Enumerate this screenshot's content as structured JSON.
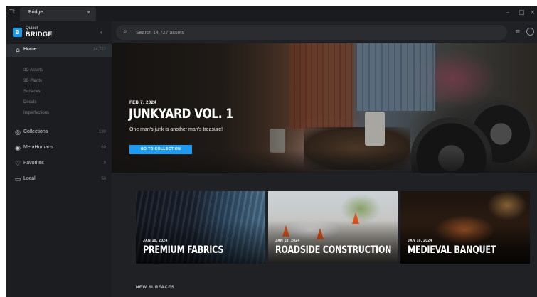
{
  "titlebar": {
    "app_glyph": "Tt",
    "tab_label": "Bridge",
    "tab_close": "×",
    "minimize": "–",
    "maximize": "□",
    "close": "×"
  },
  "sidebar": {
    "logo_mark": "B",
    "logo_brand": "Quixel",
    "logo_product": "BRIDGE",
    "collapse_glyph": "‹",
    "home": {
      "icon": "home-icon",
      "label": "Home",
      "count": "14,727"
    },
    "subitems": [
      "3D Assets",
      "3D Plants",
      "Surfaces",
      "Decals",
      "Imperfections"
    ],
    "items": [
      {
        "icon": "globe-icon",
        "label": "Collections",
        "count": "190"
      },
      {
        "icon": "metahuman-icon",
        "label": "MetaHumans",
        "count": "60"
      },
      {
        "icon": "heart-icon",
        "label": "Favorites",
        "count": "0"
      },
      {
        "icon": "monitor-icon",
        "label": "Local",
        "count": "50"
      }
    ]
  },
  "search": {
    "placeholder": "Search 14,727 assets",
    "value": ""
  },
  "hero": {
    "date": "FEB 7, 2024",
    "title": "JUNKYARD VOL. 1",
    "subtitle": "One man's junk is another man's treasure!",
    "button_label": "GO TO COLLECTION",
    "button_color": "#1e9bf0"
  },
  "cards": [
    {
      "date": "JAN 10, 2024",
      "title": "PREMIUM FABRICS"
    },
    {
      "date": "JAN 10, 2024",
      "title": "ROADSIDE CONSTRUCTION"
    },
    {
      "date": "JAN 10, 2024",
      "title": "MEDIEVAL BANQUET"
    }
  ],
  "sections": {
    "new_surfaces": "NEW SURFACES"
  },
  "colors": {
    "accent": "#1e9bf0",
    "sidebar_bg": "#1b1d20",
    "main_bg": "#1f2124"
  }
}
